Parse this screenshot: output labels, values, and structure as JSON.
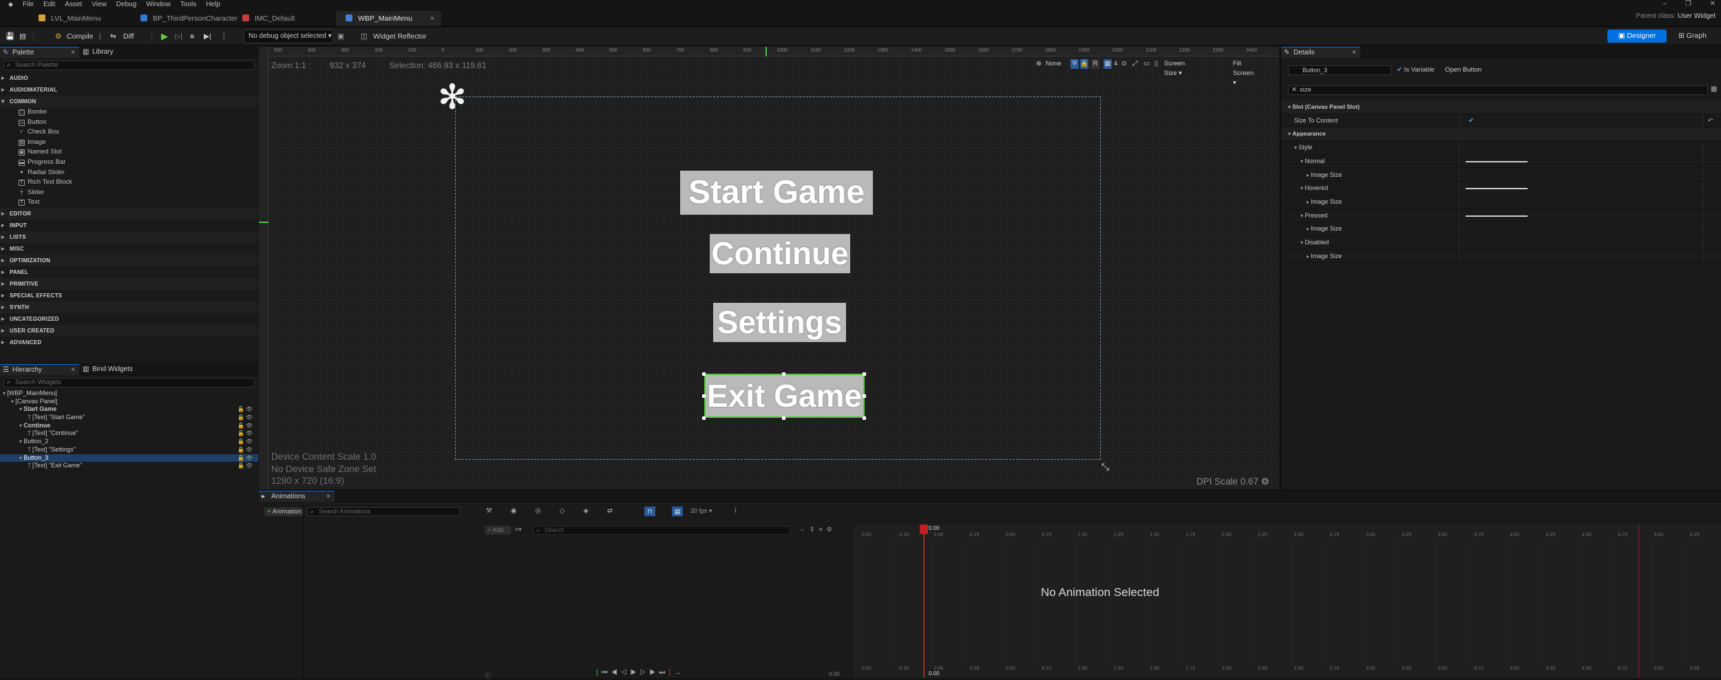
{
  "menubar": {
    "items": [
      "File",
      "Edit",
      "Asset",
      "View",
      "Debug",
      "Window",
      "Tools",
      "Help"
    ]
  },
  "window_controls": {
    "minimize": "–",
    "maximize": "❐",
    "close": "✕"
  },
  "tabs": [
    {
      "label": "LVL_MainMenu",
      "color": "#d6a23a"
    },
    {
      "label": "BP_ThirdPersonCharacter",
      "color": "#2f7bd8"
    },
    {
      "label": "IMC_Default",
      "color": "#c63d3d"
    },
    {
      "label": "WBP_MainMenu",
      "color": "#3f7fd8",
      "active": true
    }
  ],
  "tab_close": "×",
  "parent_class": {
    "label": "Parent class:",
    "value": "User Widget"
  },
  "toolbar": {
    "compile": "Compile",
    "diff": "Diff",
    "debug_object": "No debug object selected",
    "widget_reflector": "Widget Reflector",
    "designer": "Designer",
    "graph": "Graph"
  },
  "palette": {
    "tab": "Palette",
    "library_tab": "Library",
    "search_placeholder": "Search Palette",
    "categories_top": [
      "AUDIO",
      "AUDIOMATERIAL",
      "COMMON"
    ],
    "common_items": [
      {
        "label": "Border",
        "icon": "border-icon"
      },
      {
        "label": "Button",
        "icon": "button-icon"
      },
      {
        "label": "Check Box",
        "icon": "checkbox-icon"
      },
      {
        "label": "Image",
        "icon": "image-icon"
      },
      {
        "label": "Named Slot",
        "icon": "named-slot-icon"
      },
      {
        "label": "Progress Bar",
        "icon": "progress-bar-icon"
      },
      {
        "label": "Radial Slider",
        "icon": "radial-slider-icon"
      },
      {
        "label": "Rich Text Block",
        "icon": "rich-text-icon"
      },
      {
        "label": "Slider",
        "icon": "slider-icon"
      },
      {
        "label": "Text",
        "icon": "text-icon"
      }
    ],
    "categories_bottom": [
      "EDITOR",
      "INPUT",
      "LISTS",
      "MISC",
      "OPTIMIZATION",
      "PANEL",
      "PRIMITIVE",
      "SPECIAL EFFECTS",
      "SYNTH",
      "UNCATEGORIZED",
      "USER CREATED",
      "ADVANCED"
    ]
  },
  "hierarchy": {
    "tab": "Hierarchy",
    "bind_tab": "Bind Widgets",
    "search_placeholder": "Search Widgets",
    "items": [
      {
        "label": "[WBP_MainMenu]",
        "indent": 0
      },
      {
        "label": "[Canvas Panel]",
        "indent": 1
      },
      {
        "label": "Start Game",
        "indent": 2,
        "bold": true
      },
      {
        "label": "[Text] \"Start Game\"",
        "indent": 3
      },
      {
        "label": "Continue",
        "indent": 2,
        "bold": true
      },
      {
        "label": "[Text] \"Continue\"",
        "indent": 3
      },
      {
        "label": "Button_2",
        "indent": 2
      },
      {
        "label": "[Text] \"Settings\"",
        "indent": 3
      },
      {
        "label": "Button_3",
        "indent": 2,
        "selected": true
      },
      {
        "label": "[Text] \"Exit Game\"",
        "indent": 3
      }
    ]
  },
  "viewport": {
    "zoom": "Zoom 1:1",
    "size": "932 x 374",
    "selection": "Selection: 466.93 x 119.61",
    "device_scale": "Device Content Scale 1.0",
    "safe_zone": "No Device Safe Zone Set",
    "resolution": "1280 x 720 (16:9)",
    "dpi": "DPI Scale 0.67",
    "tools": {
      "none": "None",
      "r": "R",
      "grid": "4",
      "screen_size": "Screen Size",
      "fill_screen": "Fill Screen"
    },
    "ruler_top": [
      "500",
      "400",
      "300",
      "200",
      "100",
      "0",
      "100",
      "200",
      "300",
      "400",
      "500",
      "600",
      "700",
      "800",
      "900",
      "1000",
      "1100",
      "1200",
      "1300",
      "1400",
      "1500",
      "1600",
      "1700",
      "1800",
      "1900",
      "2000",
      "2100",
      "2200",
      "2300",
      "2400"
    ],
    "buttons": {
      "start": "Start Game",
      "continue": "Continue",
      "settings": "Settings",
      "exit": "Exit Game"
    }
  },
  "details": {
    "tab": "Details",
    "name": "Button_3",
    "is_variable": "Is Variable",
    "open_button": "Open Button",
    "search": "size",
    "rows": [
      {
        "label": "Slot (Canvas Panel Slot)",
        "type": "header",
        "indent": 0
      },
      {
        "label": "Size To Content",
        "type": "check",
        "indent": 1
      },
      {
        "label": "Appearance",
        "type": "header",
        "indent": 0
      },
      {
        "label": "Style",
        "type": "group",
        "indent": 1
      },
      {
        "label": "Normal",
        "type": "bar",
        "indent": 2
      },
      {
        "label": "Image Size",
        "type": "sub",
        "indent": 3
      },
      {
        "label": "Hovered",
        "type": "bar",
        "indent": 2
      },
      {
        "label": "Image Size",
        "type": "sub",
        "indent": 3
      },
      {
        "label": "Pressed",
        "type": "bar",
        "indent": 2
      },
      {
        "label": "Image Size",
        "type": "sub",
        "indent": 3
      },
      {
        "label": "Disabled",
        "type": "group",
        "indent": 2
      },
      {
        "label": "Image Size",
        "type": "sub",
        "indent": 3
      }
    ]
  },
  "animations": {
    "tab": "Animations",
    "add_animation": "Animation",
    "search_placeholder": "Search Animations",
    "add": "Add",
    "track_search": "Search",
    "fps": "20 fps",
    "time": "0.00",
    "no_selection": "No Animation Selected",
    "ticks": [
      "0.00",
      "-0.25",
      "0.00",
      "0.25",
      "0.50",
      "0.75",
      "1.00",
      "1.25",
      "1.50",
      "1.75",
      "2.00",
      "2.25",
      "2.50",
      "2.75",
      "3.00",
      "3.25",
      "3.50",
      "3.75",
      "4.00",
      "4.25",
      "4.50",
      "4.75",
      "5.00",
      "5.25"
    ],
    "end_time": "0.00"
  }
}
